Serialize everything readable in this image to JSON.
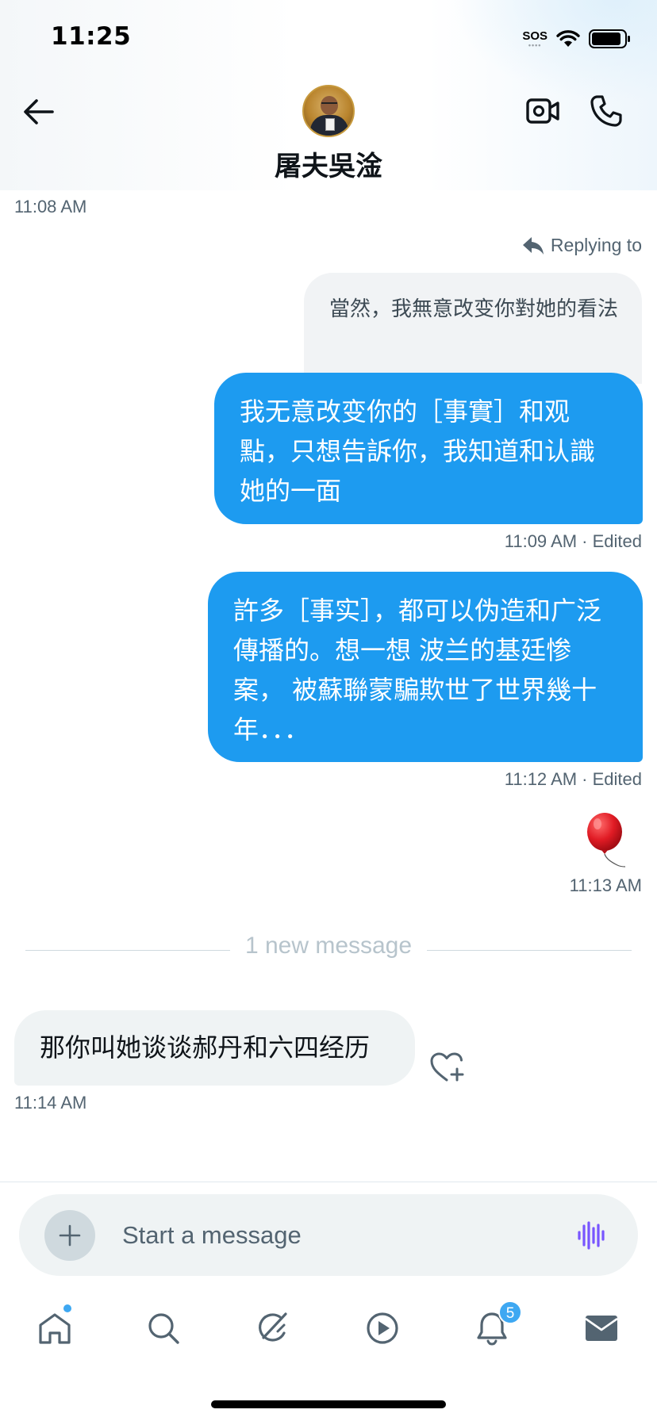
{
  "status_bar": {
    "time": "11:25",
    "sos": "SOS"
  },
  "header": {
    "contact_name": "屠夫吳淦"
  },
  "messages": {
    "ts_top": "11:08 AM",
    "reply_label": "Replying to",
    "quoted_text": "當然，我無意改变你對她的看法",
    "out_1_text": "我无意改变你的［事實］和观點，只想告訴你，我知道和认識她的一面",
    "out_1_ts": "11:09 AM · Edited",
    "out_2_text": "許多［事实］，都可以伪造和广泛傳播的。想一想 波兰的基廷惨案， 被蘇聯蒙騙欺世了世界幾十年．．．",
    "out_2_ts": "11:12 AM · Edited",
    "balloon_ts": "11:13 AM",
    "new_message_label": "1 new message",
    "in_1_text": "那你叫她谈谈郝丹和六四经历",
    "in_1_ts": "11:14 AM"
  },
  "composer": {
    "placeholder": "Start a message"
  },
  "tabbar": {
    "items": [
      "home-icon",
      "search-icon",
      "grok-icon",
      "video-icon",
      "bell-icon",
      "mail-icon"
    ],
    "notifications_badge": "5"
  },
  "colors": {
    "accent": "#1d9bf0",
    "badge": "#3ea8f2",
    "voice": "#7856ff"
  }
}
